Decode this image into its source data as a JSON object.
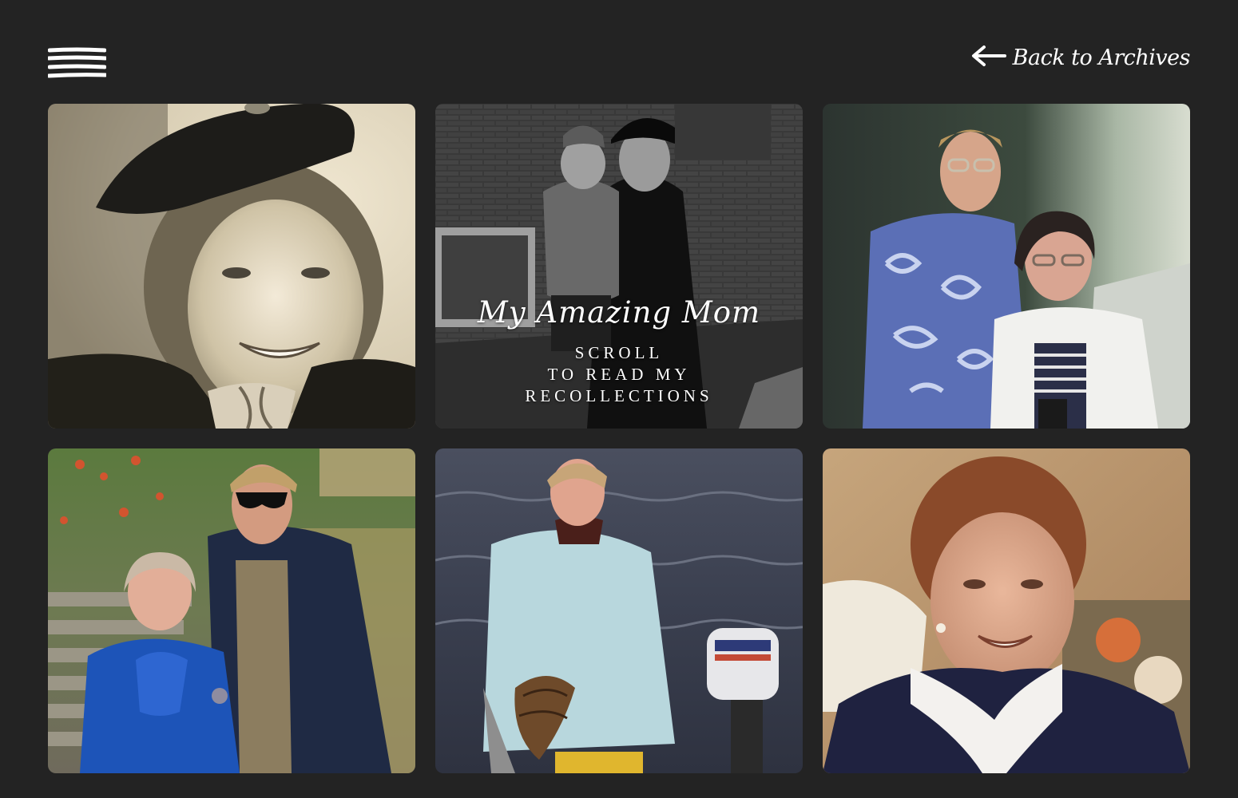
{
  "header": {
    "menu_icon": "hamburger-menu-icon",
    "back_link_icon": "arrow-left-icon",
    "back_link_label": "Back to Archives"
  },
  "hero": {
    "title": "My Amazing Mom",
    "subtitle_lines": [
      "SCROLL",
      "TO READ MY",
      "RECOLLECTIONS"
    ]
  },
  "photos": [
    {
      "name": "sepia portrait of young woman in hat"
    },
    {
      "name": "black and white photo of mother holding child"
    },
    {
      "name": "man in hawaiian shirt with older woman"
    },
    {
      "name": "older woman with man in sunglasses in garden"
    },
    {
      "name": "woman in raincoat holding fish on boat"
    },
    {
      "name": "smiling woman in dark sweater"
    }
  ],
  "colors": {
    "background": "#232323",
    "text": "#ffffff"
  }
}
